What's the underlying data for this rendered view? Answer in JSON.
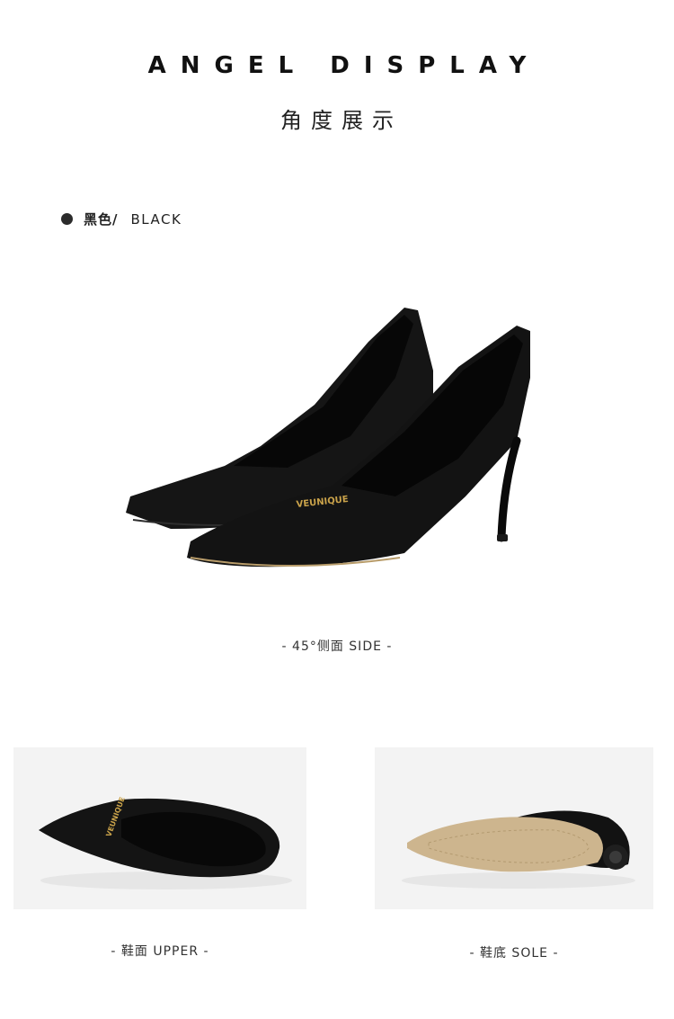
{
  "header": {
    "title_en": "ANGEL DISPLAY",
    "title_cn": "角度展示"
  },
  "color_option": {
    "name_cn": "黑色/",
    "name_en": "BLACK",
    "swatch": "#2b2b2b"
  },
  "views": {
    "side_caption": "- 45°侧面 SIDE -",
    "upper_caption": "- 鞋面 UPPER -",
    "sole_caption": "- 鞋底 SOLE -"
  },
  "product": {
    "logo_text": "VEUNIQUE",
    "colors": {
      "shoe": "#141414",
      "insole": "#0d0d0d",
      "sole": "#cdb58e",
      "logo": "#c9a24a"
    }
  }
}
